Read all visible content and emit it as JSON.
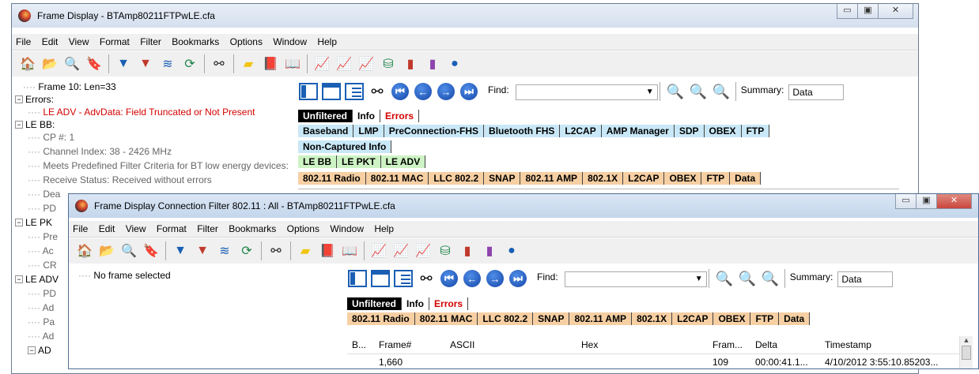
{
  "back_window": {
    "title": "Frame Display - BTAmp80211FTPwLE.cfa",
    "buttons": {
      "minimize": "▭",
      "maximize": "▣",
      "close": "✕"
    },
    "menu": [
      "File",
      "Edit",
      "View",
      "Format",
      "Filter",
      "Bookmarks",
      "Options",
      "Window",
      "Help"
    ],
    "tree": [
      "Frame 10:  Len=33",
      "Errors:",
      "LE ADV - AdvData: Field Truncated or Not Present",
      "LE BB:",
      "CP #: 1",
      "Channel Index: 38 - 2426 MHz",
      "Meets Predefined Filter Criteria for BT low energy devices:",
      "Receive Status: Received without errors",
      "Dea",
      "PD",
      "LE PK",
      "Pre",
      "Ac",
      "CR",
      "LE ADV",
      "PD",
      "Ad",
      "Pa",
      "Ad",
      "AD"
    ],
    "find_label": "Find:",
    "summary_label": "Summary:",
    "summary_value": "Data",
    "tabs_row1": [
      "Unfiltered",
      "Info",
      "Errors"
    ],
    "tabs_row2": [
      "Baseband",
      "LMP",
      "PreConnection-FHS",
      "Bluetooth FHS",
      "L2CAP",
      "AMP Manager",
      "SDP",
      "OBEX",
      "FTP"
    ],
    "tabs_row3": [
      "Non-Captured Info"
    ],
    "tabs_row4": [
      "LE BB",
      "LE PKT",
      "LE ADV"
    ],
    "tabs_row5": [
      "802.11 Radio",
      "802.11 MAC",
      "LLC 802.2",
      "SNAP",
      "802.11 AMP",
      "802.1X",
      "L2CAP",
      "OBEX",
      "FTP",
      "Data"
    ]
  },
  "front_window": {
    "title": "Frame Display  Connection Filter 802.11 : All - BTAmp80211FTPwLE.cfa",
    "buttons": {
      "minimize": "▭",
      "maximize": "▣",
      "close": "✕"
    },
    "menu": [
      "File",
      "Edit",
      "View",
      "Format",
      "Filter",
      "Bookmarks",
      "Options",
      "Window",
      "Help"
    ],
    "tree_empty": "No frame selected",
    "find_label": "Find:",
    "summary_label": "Summary:",
    "summary_value": "Data",
    "tabs_row1": [
      "Unfiltered",
      "Info",
      "Errors"
    ],
    "tabs_row2": [
      "802.11 Radio",
      "802.11 MAC",
      "LLC 802.2",
      "SNAP",
      "802.11 AMP",
      "802.1X",
      "L2CAP",
      "OBEX",
      "FTP",
      "Data"
    ],
    "columns": [
      "B...",
      "Frame#",
      "ASCII",
      "Hex",
      "Fram...",
      "Delta",
      "Timestamp"
    ],
    "rows": [
      {
        "b": "",
        "frame": "1,660",
        "ascii": "",
        "hex": "",
        "len": "109",
        "delta": "00:00:41.1...",
        "timestamp": "4/10/2012 3:55:10.85203..."
      }
    ]
  },
  "colors": {
    "unfiltered_bg": "#000000",
    "info_bg": "#ffffff",
    "errors_text": "#d40000",
    "bt_tabs_bg": "#c9e8f7",
    "le_tabs_bg": "#cdf2c4",
    "wifi_tabs_bg": "#f6cfa3",
    "close_btn": "#c9463d"
  },
  "toolbar_icons": [
    "home-icon",
    "open-folder-icon",
    "search-icon",
    "bookmark-icon",
    "filter-icon",
    "filter-remove-icon",
    "layers-icon",
    "refresh-icon",
    "binoculars-icon",
    "note-icon",
    "open-book-icon",
    "book-icon",
    "line-chart-icon",
    "line-chart-red-icon",
    "line-chart-green-icon",
    "network-icon",
    "bar-chart-icon",
    "bar-chart-multi-icon",
    "pie-icon"
  ]
}
